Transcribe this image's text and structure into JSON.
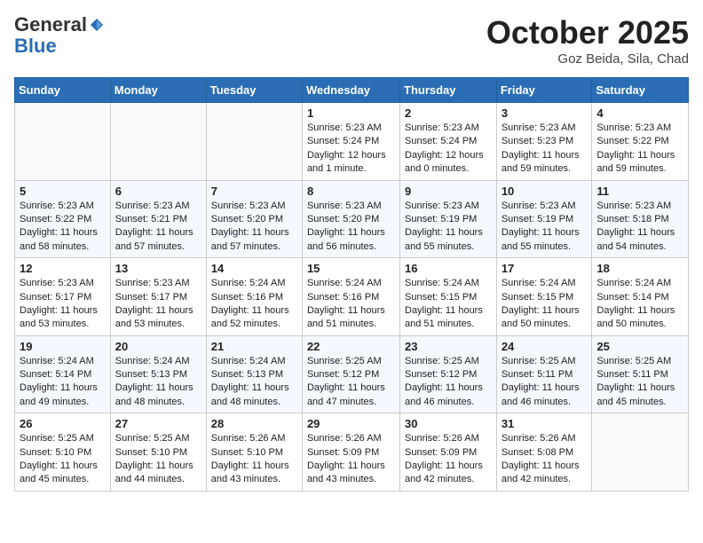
{
  "header": {
    "logo_general": "General",
    "logo_blue": "Blue",
    "month_title": "October 2025",
    "location": "Goz Beida, Sila, Chad"
  },
  "weekdays": [
    "Sunday",
    "Monday",
    "Tuesday",
    "Wednesday",
    "Thursday",
    "Friday",
    "Saturday"
  ],
  "weeks": [
    [
      {
        "day": "",
        "info": ""
      },
      {
        "day": "",
        "info": ""
      },
      {
        "day": "",
        "info": ""
      },
      {
        "day": "1",
        "info": "Sunrise: 5:23 AM\nSunset: 5:24 PM\nDaylight: 12 hours\nand 1 minute."
      },
      {
        "day": "2",
        "info": "Sunrise: 5:23 AM\nSunset: 5:24 PM\nDaylight: 12 hours\nand 0 minutes."
      },
      {
        "day": "3",
        "info": "Sunrise: 5:23 AM\nSunset: 5:23 PM\nDaylight: 11 hours\nand 59 minutes."
      },
      {
        "day": "4",
        "info": "Sunrise: 5:23 AM\nSunset: 5:22 PM\nDaylight: 11 hours\nand 59 minutes."
      }
    ],
    [
      {
        "day": "5",
        "info": "Sunrise: 5:23 AM\nSunset: 5:22 PM\nDaylight: 11 hours\nand 58 minutes."
      },
      {
        "day": "6",
        "info": "Sunrise: 5:23 AM\nSunset: 5:21 PM\nDaylight: 11 hours\nand 57 minutes."
      },
      {
        "day": "7",
        "info": "Sunrise: 5:23 AM\nSunset: 5:20 PM\nDaylight: 11 hours\nand 57 minutes."
      },
      {
        "day": "8",
        "info": "Sunrise: 5:23 AM\nSunset: 5:20 PM\nDaylight: 11 hours\nand 56 minutes."
      },
      {
        "day": "9",
        "info": "Sunrise: 5:23 AM\nSunset: 5:19 PM\nDaylight: 11 hours\nand 55 minutes."
      },
      {
        "day": "10",
        "info": "Sunrise: 5:23 AM\nSunset: 5:19 PM\nDaylight: 11 hours\nand 55 minutes."
      },
      {
        "day": "11",
        "info": "Sunrise: 5:23 AM\nSunset: 5:18 PM\nDaylight: 11 hours\nand 54 minutes."
      }
    ],
    [
      {
        "day": "12",
        "info": "Sunrise: 5:23 AM\nSunset: 5:17 PM\nDaylight: 11 hours\nand 53 minutes."
      },
      {
        "day": "13",
        "info": "Sunrise: 5:23 AM\nSunset: 5:17 PM\nDaylight: 11 hours\nand 53 minutes."
      },
      {
        "day": "14",
        "info": "Sunrise: 5:24 AM\nSunset: 5:16 PM\nDaylight: 11 hours\nand 52 minutes."
      },
      {
        "day": "15",
        "info": "Sunrise: 5:24 AM\nSunset: 5:16 PM\nDaylight: 11 hours\nand 51 minutes."
      },
      {
        "day": "16",
        "info": "Sunrise: 5:24 AM\nSunset: 5:15 PM\nDaylight: 11 hours\nand 51 minutes."
      },
      {
        "day": "17",
        "info": "Sunrise: 5:24 AM\nSunset: 5:15 PM\nDaylight: 11 hours\nand 50 minutes."
      },
      {
        "day": "18",
        "info": "Sunrise: 5:24 AM\nSunset: 5:14 PM\nDaylight: 11 hours\nand 50 minutes."
      }
    ],
    [
      {
        "day": "19",
        "info": "Sunrise: 5:24 AM\nSunset: 5:14 PM\nDaylight: 11 hours\nand 49 minutes."
      },
      {
        "day": "20",
        "info": "Sunrise: 5:24 AM\nSunset: 5:13 PM\nDaylight: 11 hours\nand 48 minutes."
      },
      {
        "day": "21",
        "info": "Sunrise: 5:24 AM\nSunset: 5:13 PM\nDaylight: 11 hours\nand 48 minutes."
      },
      {
        "day": "22",
        "info": "Sunrise: 5:25 AM\nSunset: 5:12 PM\nDaylight: 11 hours\nand 47 minutes."
      },
      {
        "day": "23",
        "info": "Sunrise: 5:25 AM\nSunset: 5:12 PM\nDaylight: 11 hours\nand 46 minutes."
      },
      {
        "day": "24",
        "info": "Sunrise: 5:25 AM\nSunset: 5:11 PM\nDaylight: 11 hours\nand 46 minutes."
      },
      {
        "day": "25",
        "info": "Sunrise: 5:25 AM\nSunset: 5:11 PM\nDaylight: 11 hours\nand 45 minutes."
      }
    ],
    [
      {
        "day": "26",
        "info": "Sunrise: 5:25 AM\nSunset: 5:10 PM\nDaylight: 11 hours\nand 45 minutes."
      },
      {
        "day": "27",
        "info": "Sunrise: 5:25 AM\nSunset: 5:10 PM\nDaylight: 11 hours\nand 44 minutes."
      },
      {
        "day": "28",
        "info": "Sunrise: 5:26 AM\nSunset: 5:10 PM\nDaylight: 11 hours\nand 43 minutes."
      },
      {
        "day": "29",
        "info": "Sunrise: 5:26 AM\nSunset: 5:09 PM\nDaylight: 11 hours\nand 43 minutes."
      },
      {
        "day": "30",
        "info": "Sunrise: 5:26 AM\nSunset: 5:09 PM\nDaylight: 11 hours\nand 42 minutes."
      },
      {
        "day": "31",
        "info": "Sunrise: 5:26 AM\nSunset: 5:08 PM\nDaylight: 11 hours\nand 42 minutes."
      },
      {
        "day": "",
        "info": ""
      }
    ]
  ]
}
